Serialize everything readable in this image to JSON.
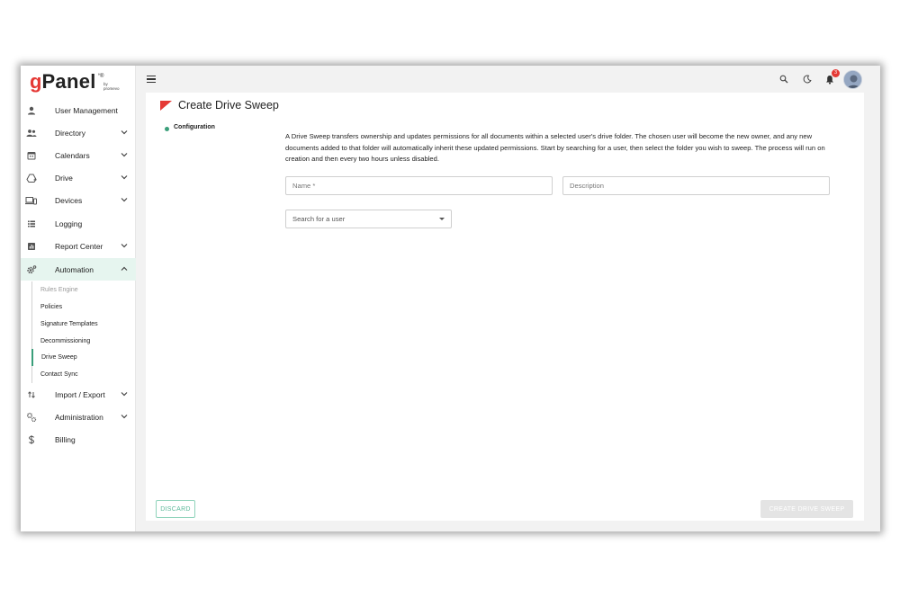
{
  "brand": {
    "logo_g": "g",
    "logo_panel": "Panel",
    "logo_mark": "°®",
    "logo_by": "by",
    "logo_vendor": "promevo"
  },
  "sidebar": {
    "items": [
      {
        "label": "User Management",
        "icon": "person-icon",
        "chevron": false
      },
      {
        "label": "Directory",
        "icon": "people-icon",
        "chevron": true
      },
      {
        "label": "Calendars",
        "icon": "calendar-icon",
        "chevron": true
      },
      {
        "label": "Drive",
        "icon": "drive-icon",
        "chevron": true
      },
      {
        "label": "Devices",
        "icon": "devices-icon",
        "chevron": true
      },
      {
        "label": "Logging",
        "icon": "list-icon",
        "chevron": false
      },
      {
        "label": "Report Center",
        "icon": "report-icon",
        "chevron": true
      },
      {
        "label": "Automation",
        "icon": "gear-icon",
        "chevron": true,
        "expanded": true
      },
      {
        "label": "Import / Export",
        "icon": "import-export-icon",
        "chevron": true
      },
      {
        "label": "Administration",
        "icon": "admin-gears-icon",
        "chevron": true
      },
      {
        "label": "Billing",
        "icon": "dollar-icon",
        "chevron": false
      }
    ],
    "automation_sub": [
      {
        "label": "Rules Engine",
        "muted": true
      },
      {
        "label": "Policies"
      },
      {
        "label": "Signature Templates"
      },
      {
        "label": "Decommissioning"
      },
      {
        "label": "Drive Sweep",
        "current": true
      },
      {
        "label": "Contact Sync"
      }
    ]
  },
  "header": {
    "notification_count": "3",
    "icons": [
      "menu-icon",
      "search-icon",
      "moon-icon",
      "bell-icon",
      "avatar"
    ]
  },
  "main": {
    "title": "Create Drive Sweep",
    "step_label": "Configuration",
    "description": "A Drive Sweep transfers ownership and updates permissions for all documents within a selected user's drive folder. The chosen user will become the new owner, and any new documents added to that folder will automatically inherit these updated permissions. Start by searching for a user, then select the folder you wish to sweep. The process will run on creation and then every two hours unless disabled.",
    "name_placeholder": "Name *",
    "description_placeholder": "Description",
    "user_search_placeholder": "Search for a user",
    "discard_label": "DISCARD",
    "create_label": "CREATE DRIVE SWEEP"
  },
  "colors": {
    "accent": "#3a9e7a",
    "brand_red": "#e53935",
    "active_bg": "#e6f5ef"
  }
}
